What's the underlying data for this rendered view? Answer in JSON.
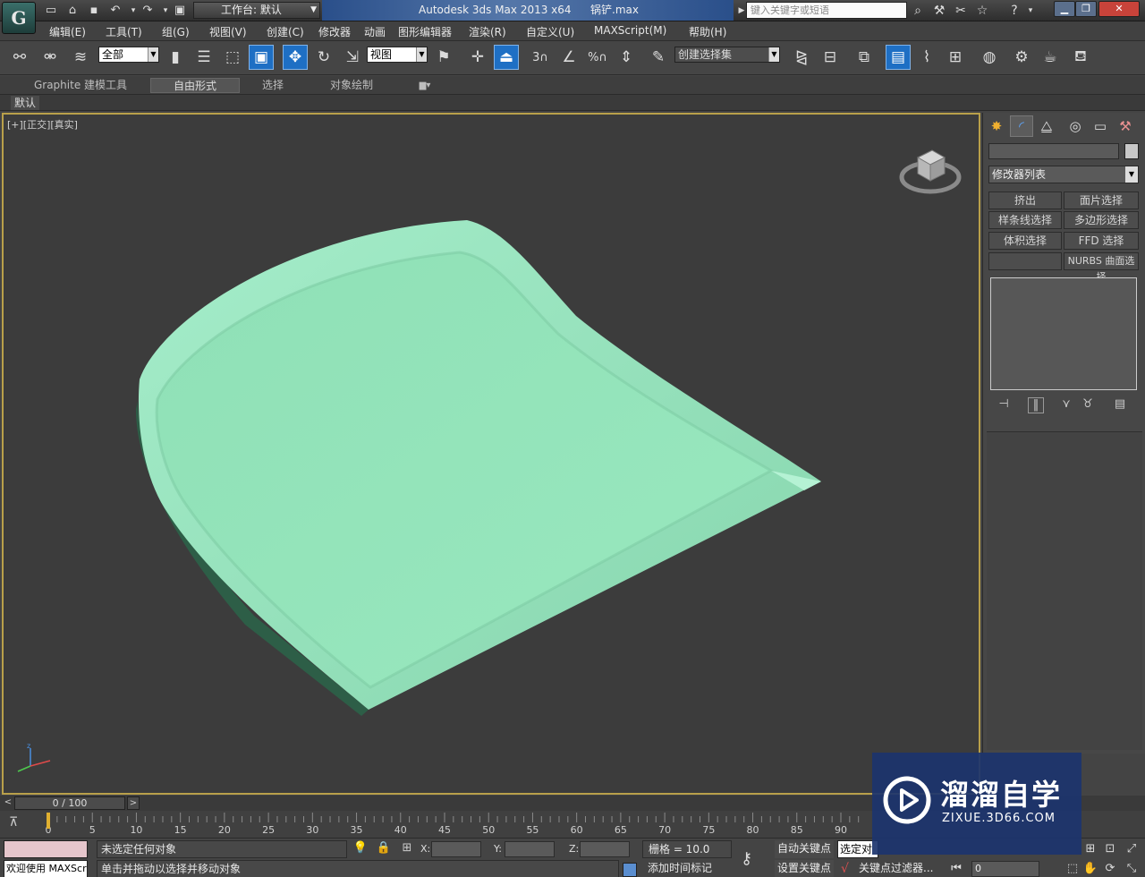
{
  "titlebar": {
    "workspace_label": "工作台: 默认",
    "app_title": "Autodesk 3ds Max  2013 x64",
    "file_name": "锅铲.max",
    "search_placeholder": "键入关键字或短语"
  },
  "menu": {
    "items": [
      "编辑(E)",
      "工具(T)",
      "组(G)",
      "视图(V)",
      "创建(C)",
      "修改器",
      "动画",
      "图形编辑器",
      "渲染(R)",
      "自定义(U)",
      "MAXScript(M)",
      "帮助(H)"
    ]
  },
  "toolbar": {
    "selection_filter": "全部",
    "ref_coord": "视图",
    "named_selection": "创建选择集",
    "snap_3": "3",
    "snap_pct": "%"
  },
  "ribbon": {
    "tabs": [
      "Graphite 建模工具",
      "自由形式",
      "选择",
      "对象绘制"
    ],
    "active_tab": "自由形式",
    "panel_label": "默认"
  },
  "viewport": {
    "label": "[+][正交][真实]",
    "model_color": "#96e6bd",
    "border_color": "#b9a04a"
  },
  "command_panel": {
    "modifier_list": "修改器列表",
    "buttons": [
      "挤出",
      "面片选择",
      "样条线选择",
      "多边形选择",
      "体积选择",
      "FFD 选择",
      "",
      "NURBS 曲面选择"
    ]
  },
  "timeline": {
    "frame_display": "0 / 100",
    "ticks": [
      "0",
      "5",
      "10",
      "15",
      "20",
      "25",
      "30",
      "35",
      "40",
      "45",
      "50",
      "55",
      "60",
      "65",
      "70",
      "75",
      "80",
      "85",
      "90"
    ]
  },
  "status": {
    "listener": "欢迎使用 MAXScr",
    "line1": "未选定任何对象",
    "line2": "单击并拖动以选择并移动对象",
    "x_label": "X:",
    "y_label": "Y:",
    "z_label": "Z:",
    "grid": "栅格 = 10.0",
    "add_time_tag": "添加时间标记",
    "auto_key": "自动关键点",
    "set_key": "设置关键点",
    "selected_dd": "选定对",
    "key_filters": "关键点过滤器...",
    "frame_value": "0"
  },
  "watermark": {
    "title": "溜溜自学",
    "url": "ZIXUE.3D66.COM"
  }
}
